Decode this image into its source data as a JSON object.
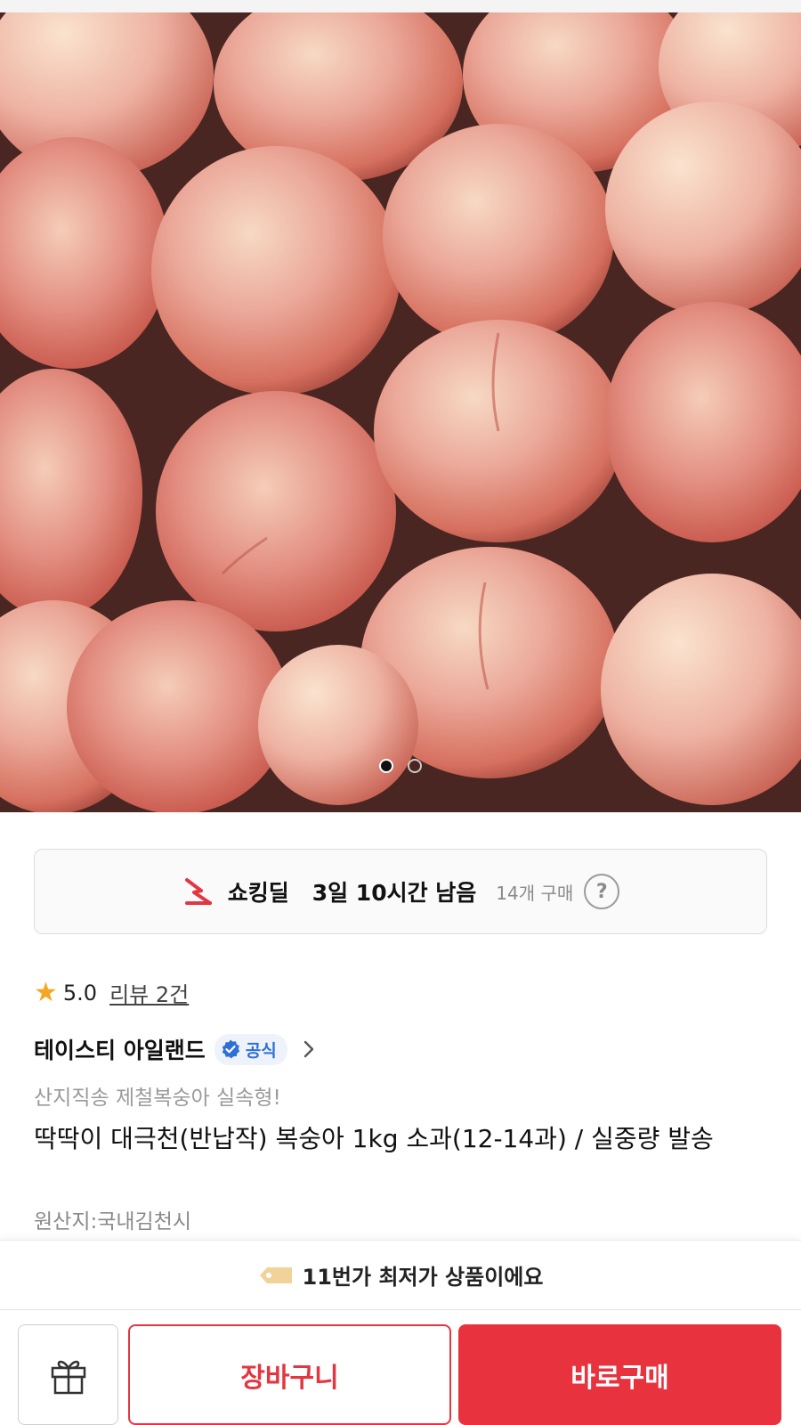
{
  "hero": {
    "image_subject": "peaches",
    "slide_count": 2,
    "active_slide": 1
  },
  "deal": {
    "label": "쇼킹딜",
    "time_left": "3일 10시간 남음",
    "purchase_count": "14개 구매",
    "help_symbol": "?",
    "accent_color": "#e23742"
  },
  "rating": {
    "value": "5.0",
    "review_link": "리뷰 2건",
    "star_color": "#f5a623"
  },
  "seller": {
    "name": "테이스티 아일랜드",
    "badge_label": "공식"
  },
  "product": {
    "subtitle": "산지직송 제철복숭아 실속형!",
    "title": "딱딱이 대극천(반납작) 복숭아 1kg 소과(12-14과) / 실중량 발송",
    "origin": "원산지:국내김천시"
  },
  "banner": {
    "text": "11번가 최저가 상품이에요"
  },
  "actions": {
    "cart_label": "장바구니",
    "buy_label": "바로구매",
    "primary_color": "#e8333f"
  }
}
